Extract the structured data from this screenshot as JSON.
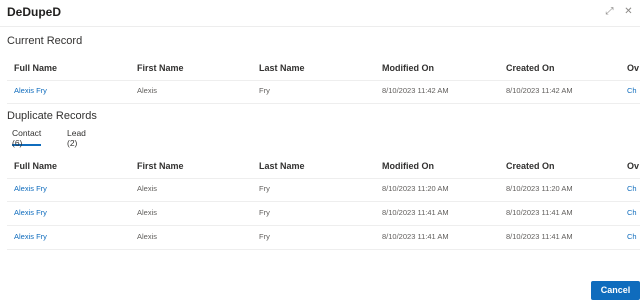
{
  "app": {
    "title": "DeDupeD",
    "actions": [
      {
        "name": "expand-icon",
        "glyph": "⤢"
      },
      {
        "name": "close-icon",
        "glyph": "✕"
      }
    ]
  },
  "current_record": {
    "title": "Current Record",
    "columns": [
      "Full Name",
      "First Name",
      "Last Name",
      "Modified On",
      "Created On",
      "Ov"
    ],
    "rows": [
      [
        "Alexis Fry",
        "Alexis",
        "Fry",
        "8/10/2023 11:42 AM",
        "8/10/2023 11:42 AM",
        "Ch"
      ]
    ]
  },
  "duplicates": {
    "title": "Duplicate Records",
    "tabs": [
      {
        "label": "Contact (6)",
        "active": true
      },
      {
        "label": "Lead (2)",
        "active": false
      }
    ],
    "columns": [
      "Full Name",
      "First Name",
      "Last Name",
      "Modified On",
      "Created On",
      "Ov"
    ],
    "rows": [
      [
        "Alexis Fry",
        "Alexis",
        "Fry",
        "8/10/2023 11:20 AM",
        "8/10/2023 11:20 AM",
        "Ch"
      ],
      [
        "Alexis Fry",
        "Alexis",
        "Fry",
        "8/10/2023 11:41 AM",
        "8/10/2023 11:41 AM",
        "Ch"
      ],
      [
        "Alexis Fry",
        "Alexis",
        "Fry",
        "8/10/2023 11:41 AM",
        "8/10/2023 11:41 AM",
        "Ch"
      ]
    ]
  },
  "footer": {
    "cancel_label": "Cancel"
  },
  "colors": {
    "accent": "#0f6cbd",
    "link": "#0f6cbd",
    "border": "#eeeeee"
  }
}
